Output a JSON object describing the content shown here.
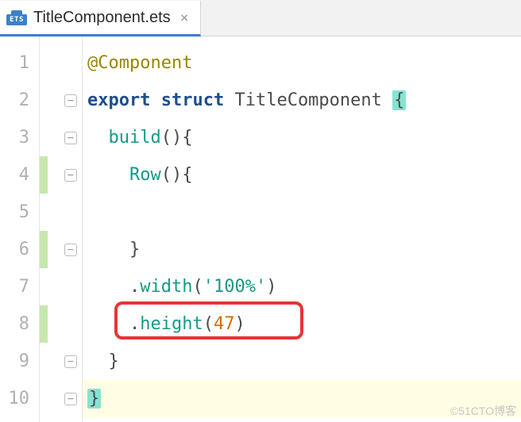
{
  "tab": {
    "icon_label": "ETS",
    "filename": "TitleComponent.ets",
    "close_glyph": "×"
  },
  "gutter": {
    "nums": [
      "1",
      "2",
      "3",
      "4",
      "5",
      "6",
      "7",
      "8",
      "9",
      "10"
    ]
  },
  "code": {
    "l1_anno": "@Component",
    "l2_kw1": "export",
    "l2_kw2": "struct",
    "l2_type": "TitleComponent",
    "l2_brace": "{",
    "l3_fn": "build",
    "l3_paren": "()",
    "l3_brace": "{",
    "l4_fn": "Row",
    "l4_paren": "()",
    "l4_brace": "{",
    "l6_brace": "}",
    "l7_dot": ".",
    "l7_fn": "width",
    "l7_p1": "(",
    "l7_str": "'100%'",
    "l7_p2": ")",
    "l8_dot": ".",
    "l8_fn": "height",
    "l8_p1": "(",
    "l8_num": "47",
    "l8_p2": ")",
    "l9_brace": "}",
    "l10_brace": "}"
  },
  "fold": {
    "minus": "−"
  },
  "watermark": "©51CTO博客"
}
